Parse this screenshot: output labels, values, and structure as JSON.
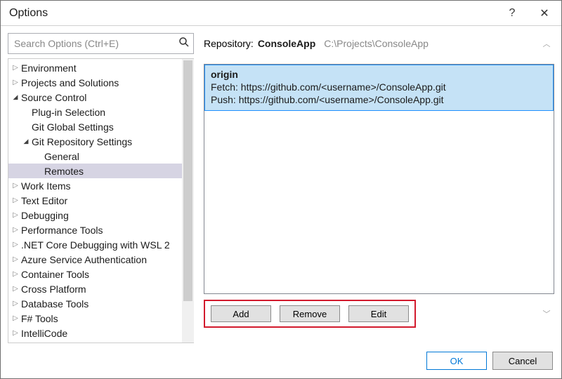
{
  "window": {
    "title": "Options"
  },
  "search": {
    "placeholder": "Search Options (Ctrl+E)"
  },
  "tree": [
    {
      "label": "Environment",
      "level": 0,
      "arrow": "collapsed"
    },
    {
      "label": "Projects and Solutions",
      "level": 0,
      "arrow": "collapsed"
    },
    {
      "label": "Source Control",
      "level": 0,
      "arrow": "expanded"
    },
    {
      "label": "Plug-in Selection",
      "level": 1,
      "arrow": "none"
    },
    {
      "label": "Git Global Settings",
      "level": 1,
      "arrow": "none"
    },
    {
      "label": "Git Repository Settings",
      "level": 1,
      "arrow": "expanded"
    },
    {
      "label": "General",
      "level": 2,
      "arrow": "none"
    },
    {
      "label": "Remotes",
      "level": 2,
      "arrow": "none",
      "selected": true
    },
    {
      "label": "Work Items",
      "level": 0,
      "arrow": "collapsed"
    },
    {
      "label": "Text Editor",
      "level": 0,
      "arrow": "collapsed"
    },
    {
      "label": "Debugging",
      "level": 0,
      "arrow": "collapsed"
    },
    {
      "label": "Performance Tools",
      "level": 0,
      "arrow": "collapsed"
    },
    {
      "label": ".NET Core Debugging with WSL 2",
      "level": 0,
      "arrow": "collapsed"
    },
    {
      "label": "Azure Service Authentication",
      "level": 0,
      "arrow": "collapsed"
    },
    {
      "label": "Container Tools",
      "level": 0,
      "arrow": "collapsed"
    },
    {
      "label": "Cross Platform",
      "level": 0,
      "arrow": "collapsed"
    },
    {
      "label": "Database Tools",
      "level": 0,
      "arrow": "collapsed"
    },
    {
      "label": "F# Tools",
      "level": 0,
      "arrow": "collapsed"
    },
    {
      "label": "IntelliCode",
      "level": 0,
      "arrow": "collapsed"
    }
  ],
  "header": {
    "repo_label": "Repository:",
    "repo_name": "ConsoleApp",
    "repo_path": "C:\\Projects\\ConsoleApp"
  },
  "remote": {
    "name": "origin",
    "fetch_label": "Fetch: https://github.com/<username>/ConsoleApp.git",
    "push_label": "Push: https://github.com/<username>/ConsoleApp.git"
  },
  "buttons": {
    "add": "Add",
    "remove": "Remove",
    "edit": "Edit"
  },
  "footer": {
    "ok": "OK",
    "cancel": "Cancel"
  }
}
